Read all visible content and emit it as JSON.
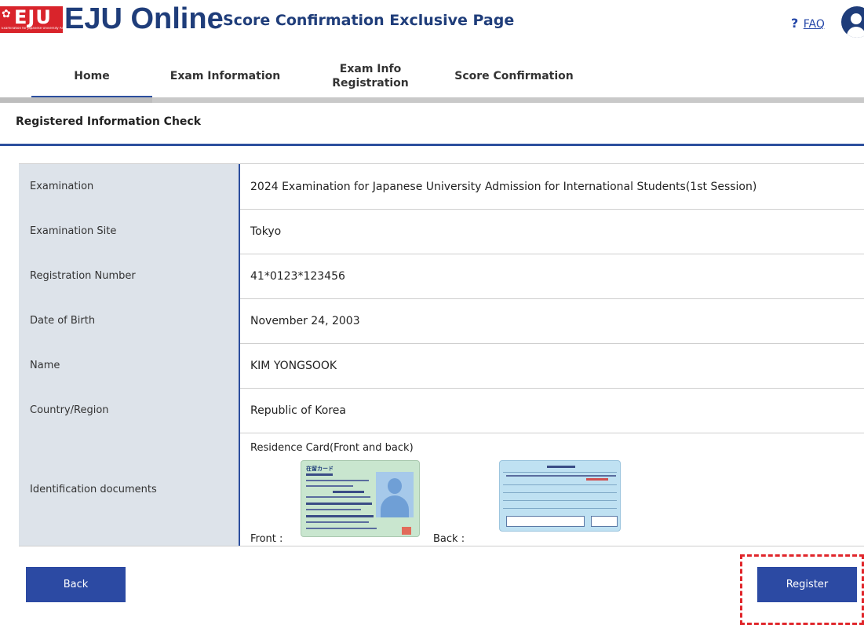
{
  "header": {
    "brand_mark": "EJU",
    "brand_tagline": "Examination for Japanese University Admission for International Students",
    "brand_title": "EJU Online",
    "page_subtitle": "Score Confirmation Exclusive Page",
    "faq_question_mark": "?",
    "faq_label": "FAQ"
  },
  "nav": {
    "items": [
      {
        "label": "Home",
        "active": true
      },
      {
        "label": "Exam Information",
        "active": false
      },
      {
        "label": "Exam Info\nRegistration",
        "active": false
      },
      {
        "label": "Score Confirmation",
        "active": false
      }
    ]
  },
  "section": {
    "title": "Registered Information Check"
  },
  "info": {
    "rows": [
      {
        "label": "Examination",
        "value": "2024 Examination for Japanese University Admission for International Students(1st Session)"
      },
      {
        "label": "Examination Site",
        "value": "Tokyo"
      },
      {
        "label": "Registration Number",
        "value": "41*0123*123456"
      },
      {
        "label": "Date of Birth",
        "value": "November 24, 2003"
      },
      {
        "label": "Name",
        "value": "KIM YONGSOOK"
      },
      {
        "label": "Country/Region",
        "value": "Republic of Korea"
      }
    ],
    "id_docs": {
      "label": "Identification documents",
      "doc_type": "Residence Card(Front and back)",
      "front_label": "Front :",
      "back_label": "Back :",
      "front_card_title": "在留カード"
    }
  },
  "buttons": {
    "back": "Back",
    "register": "Register"
  },
  "colors": {
    "brand_red": "#d9242b",
    "brand_navy": "#1f3d7a",
    "button_blue": "#2c4aa3",
    "label_bg": "#dde3ea",
    "highlight_red": "#e0262b"
  }
}
